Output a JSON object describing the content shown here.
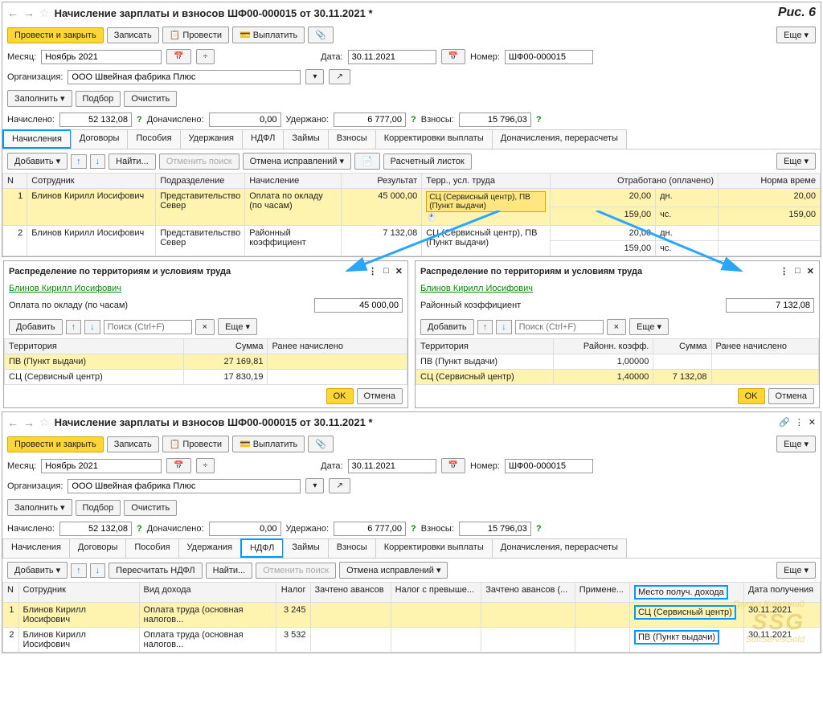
{
  "fig_label": "Рис. 6",
  "window_title": "Начисление зарплаты и взносов ШФ00-000015 от 30.11.2021 *",
  "btns": {
    "post_close": "Провести и закрыть",
    "save": "Записать",
    "post": "Провести",
    "pay": "Выплатить",
    "more": "Еще",
    "fill": "Заполнить",
    "pick": "Подбор",
    "clear": "Очистить",
    "add": "Добавить",
    "find": "Найти...",
    "cancel_search": "Отменить поиск",
    "cancel_fix": "Отмена исправлений",
    "payslip": "Расчетный листок",
    "ok": "OK",
    "cancel": "Отмена",
    "recalc_ndfl": "Пересчитать НДФЛ"
  },
  "fields": {
    "month_lbl": "Месяц:",
    "month_val": "Ноябрь 2021",
    "date_lbl": "Дата:",
    "date_val": "30.11.2021",
    "num_lbl": "Номер:",
    "num_val": "ШФ00-000015",
    "org_lbl": "Организация:",
    "org_val": "ООО Швейная фабрика Плюс",
    "accrued_lbl": "Начислено:",
    "accrued_val": "52 132,08",
    "extra_lbl": "Доначислено:",
    "extra_val": "0,00",
    "withheld_lbl": "Удержано:",
    "withheld_val": "6 777,00",
    "contrib_lbl": "Взносы:",
    "contrib_val": "15 796,03"
  },
  "tabs": [
    "Начисления",
    "Договоры",
    "Пособия",
    "Удержания",
    "НДФЛ",
    "Займы",
    "Взносы",
    "Корректировки выплаты",
    "Доначисления, перерасчеты"
  ],
  "cols": {
    "n": "N",
    "emp": "Сотрудник",
    "dep": "Подразделение",
    "accr": "Начисление",
    "res": "Результат",
    "terr": "Терр., усл. труда",
    "worked": "Отработано (оплачено)",
    "norm": "Норма време"
  },
  "rows": [
    {
      "n": "1",
      "emp": "Блинов Кирилл Иосифович",
      "dep": "Представительство Север",
      "accr": "Оплата по окладу (по часам)",
      "res": "45 000,00",
      "terr": "СЦ (Сервисный центр), ПВ (Пункт выдачи)",
      "d1": "20,00",
      "u1": "дн.",
      "d2": "159,00",
      "u2": "чс.",
      "n1": "20,00",
      "n2": "159,00"
    },
    {
      "n": "2",
      "emp": "Блинов Кирилл Иосифович",
      "dep": "Представительство Север",
      "accr": "Районный коэффициент",
      "res": "7 132,08",
      "terr": "СЦ (Сервисный центр), ПВ (Пункт выдачи)",
      "d1": "20,00",
      "u1": "дн.",
      "d2": "159,00",
      "u2": "чс.",
      "n1": "",
      "n2": ""
    }
  ],
  "popup_title": "Распределение по территориям и условиям труда",
  "employee": "Блинов Кирилл Иосифович",
  "popup1": {
    "line_lbl": "Оплата по окладу (по часам)",
    "line_val": "45 000,00",
    "search_ph": "Поиск (Ctrl+F)",
    "cols": {
      "terr": "Территория",
      "sum": "Сумма",
      "prev": "Ранее начислено"
    },
    "rows": [
      {
        "t": "ПВ (Пункт выдачи)",
        "s": "27 169,81"
      },
      {
        "t": "СЦ (Сервисный центр)",
        "s": "17 830,19"
      }
    ]
  },
  "popup2": {
    "line_lbl": "Районный коэффициент",
    "line_val": "7 132,08",
    "search_ph": "Поиск (Ctrl+F)",
    "cols": {
      "terr": "Территория",
      "coef": "Районн. коэфф.",
      "sum": "Сумма",
      "prev": "Ранее начислено"
    },
    "rows": [
      {
        "t": "ПВ (Пункт выдачи)",
        "c": "1,00000",
        "s": ""
      },
      {
        "t": "СЦ (Сервисный центр)",
        "c": "1,40000",
        "s": "7 132,08"
      }
    ]
  },
  "lower_cols": {
    "n": "N",
    "emp": "Сотрудник",
    "income": "Вид дохода",
    "tax": "Налог",
    "adv": "Зачтено авансов",
    "excess": "Налог с превыше...",
    "adv2": "Зачтено авансов (...",
    "app": "Примене...",
    "place": "Место получ. дохода",
    "date": "Дата получения"
  },
  "lower_rows": [
    {
      "n": "1",
      "emp": "Блинов Кирилл Иосифович",
      "income": "Оплата труда (основная налогов...",
      "tax": "3 245",
      "place": "СЦ (Сервисный центр)",
      "date": "30.11.2021"
    },
    {
      "n": "2",
      "emp": "Блинов Кирилл Иосифович",
      "income": "Оплата труда (основная налогов...",
      "tax": "3 532",
      "place": "ПВ (Пункт выдачи)",
      "date": "30.11.2021"
    }
  ],
  "watermark": {
    "top": "Группа Компаний",
    "logo": "SSG",
    "bottom": "SoftServisGold"
  }
}
